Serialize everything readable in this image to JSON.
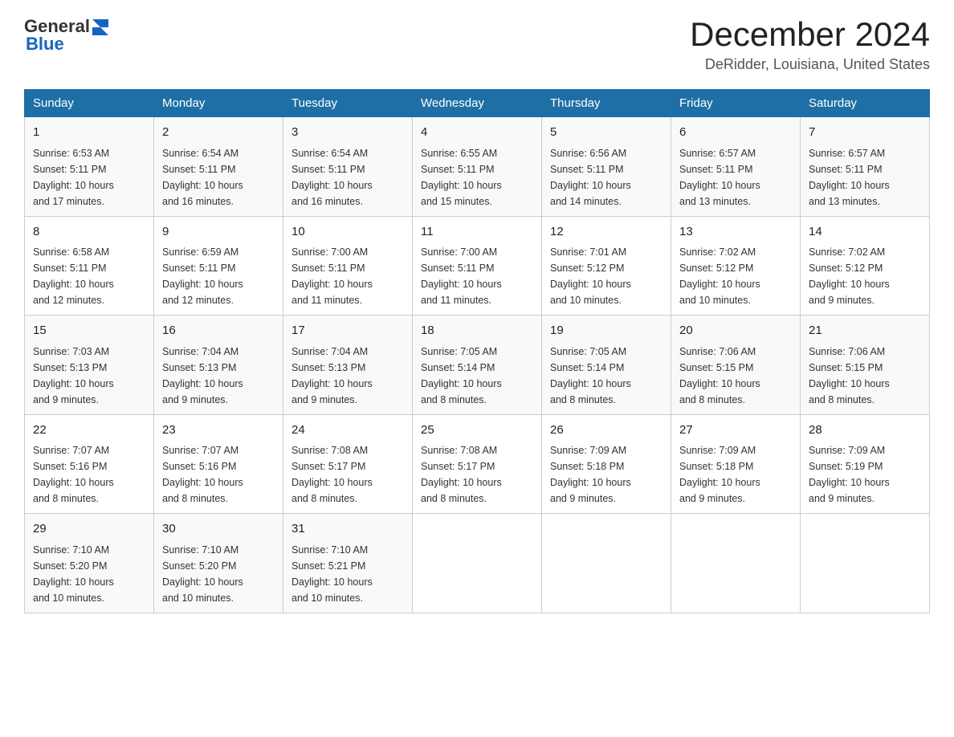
{
  "header": {
    "logo_general": "General",
    "logo_blue": "Blue",
    "month_title": "December 2024",
    "location": "DeRidder, Louisiana, United States"
  },
  "days_of_week": [
    "Sunday",
    "Monday",
    "Tuesday",
    "Wednesday",
    "Thursday",
    "Friday",
    "Saturday"
  ],
  "weeks": [
    [
      {
        "day": "1",
        "sunrise": "6:53 AM",
        "sunset": "5:11 PM",
        "daylight": "10 hours and 17 minutes."
      },
      {
        "day": "2",
        "sunrise": "6:54 AM",
        "sunset": "5:11 PM",
        "daylight": "10 hours and 16 minutes."
      },
      {
        "day": "3",
        "sunrise": "6:54 AM",
        "sunset": "5:11 PM",
        "daylight": "10 hours and 16 minutes."
      },
      {
        "day": "4",
        "sunrise": "6:55 AM",
        "sunset": "5:11 PM",
        "daylight": "10 hours and 15 minutes."
      },
      {
        "day": "5",
        "sunrise": "6:56 AM",
        "sunset": "5:11 PM",
        "daylight": "10 hours and 14 minutes."
      },
      {
        "day": "6",
        "sunrise": "6:57 AM",
        "sunset": "5:11 PM",
        "daylight": "10 hours and 13 minutes."
      },
      {
        "day": "7",
        "sunrise": "6:57 AM",
        "sunset": "5:11 PM",
        "daylight": "10 hours and 13 minutes."
      }
    ],
    [
      {
        "day": "8",
        "sunrise": "6:58 AM",
        "sunset": "5:11 PM",
        "daylight": "10 hours and 12 minutes."
      },
      {
        "day": "9",
        "sunrise": "6:59 AM",
        "sunset": "5:11 PM",
        "daylight": "10 hours and 12 minutes."
      },
      {
        "day": "10",
        "sunrise": "7:00 AM",
        "sunset": "5:11 PM",
        "daylight": "10 hours and 11 minutes."
      },
      {
        "day": "11",
        "sunrise": "7:00 AM",
        "sunset": "5:11 PM",
        "daylight": "10 hours and 11 minutes."
      },
      {
        "day": "12",
        "sunrise": "7:01 AM",
        "sunset": "5:12 PM",
        "daylight": "10 hours and 10 minutes."
      },
      {
        "day": "13",
        "sunrise": "7:02 AM",
        "sunset": "5:12 PM",
        "daylight": "10 hours and 10 minutes."
      },
      {
        "day": "14",
        "sunrise": "7:02 AM",
        "sunset": "5:12 PM",
        "daylight": "10 hours and 9 minutes."
      }
    ],
    [
      {
        "day": "15",
        "sunrise": "7:03 AM",
        "sunset": "5:13 PM",
        "daylight": "10 hours and 9 minutes."
      },
      {
        "day": "16",
        "sunrise": "7:04 AM",
        "sunset": "5:13 PM",
        "daylight": "10 hours and 9 minutes."
      },
      {
        "day": "17",
        "sunrise": "7:04 AM",
        "sunset": "5:13 PM",
        "daylight": "10 hours and 9 minutes."
      },
      {
        "day": "18",
        "sunrise": "7:05 AM",
        "sunset": "5:14 PM",
        "daylight": "10 hours and 8 minutes."
      },
      {
        "day": "19",
        "sunrise": "7:05 AM",
        "sunset": "5:14 PM",
        "daylight": "10 hours and 8 minutes."
      },
      {
        "day": "20",
        "sunrise": "7:06 AM",
        "sunset": "5:15 PM",
        "daylight": "10 hours and 8 minutes."
      },
      {
        "day": "21",
        "sunrise": "7:06 AM",
        "sunset": "5:15 PM",
        "daylight": "10 hours and 8 minutes."
      }
    ],
    [
      {
        "day": "22",
        "sunrise": "7:07 AM",
        "sunset": "5:16 PM",
        "daylight": "10 hours and 8 minutes."
      },
      {
        "day": "23",
        "sunrise": "7:07 AM",
        "sunset": "5:16 PM",
        "daylight": "10 hours and 8 minutes."
      },
      {
        "day": "24",
        "sunrise": "7:08 AM",
        "sunset": "5:17 PM",
        "daylight": "10 hours and 8 minutes."
      },
      {
        "day": "25",
        "sunrise": "7:08 AM",
        "sunset": "5:17 PM",
        "daylight": "10 hours and 8 minutes."
      },
      {
        "day": "26",
        "sunrise": "7:09 AM",
        "sunset": "5:18 PM",
        "daylight": "10 hours and 9 minutes."
      },
      {
        "day": "27",
        "sunrise": "7:09 AM",
        "sunset": "5:18 PM",
        "daylight": "10 hours and 9 minutes."
      },
      {
        "day": "28",
        "sunrise": "7:09 AM",
        "sunset": "5:19 PM",
        "daylight": "10 hours and 9 minutes."
      }
    ],
    [
      {
        "day": "29",
        "sunrise": "7:10 AM",
        "sunset": "5:20 PM",
        "daylight": "10 hours and 10 minutes."
      },
      {
        "day": "30",
        "sunrise": "7:10 AM",
        "sunset": "5:20 PM",
        "daylight": "10 hours and 10 minutes."
      },
      {
        "day": "31",
        "sunrise": "7:10 AM",
        "sunset": "5:21 PM",
        "daylight": "10 hours and 10 minutes."
      },
      null,
      null,
      null,
      null
    ]
  ],
  "labels": {
    "sunrise": "Sunrise:",
    "sunset": "Sunset:",
    "daylight": "Daylight:"
  }
}
